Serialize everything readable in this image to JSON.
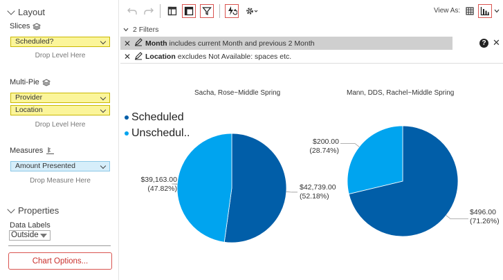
{
  "left_panel": {
    "layout_label": "Layout",
    "slices_label": "Slices",
    "slices_field": "Scheduled?",
    "slices_drop": "Drop Level Here",
    "multipie_label": "Multi-Pie",
    "multipie_fields": [
      "Provider",
      "Location"
    ],
    "multipie_drop": "Drop Level Here",
    "measures_label": "Measures",
    "measures_field": "Amount Presented",
    "measures_drop": "Drop Measure Here",
    "properties_label": "Properties",
    "data_labels_label": "Data Labels",
    "data_labels_value": "Outside",
    "chart_options_label": "Chart Options..."
  },
  "toolbar": {
    "view_as_label": "View As:"
  },
  "filters": {
    "header": "2 Filters",
    "rows": [
      {
        "field": "Month",
        "text": "includes current Month and previous 2 Month"
      },
      {
        "field": "Location",
        "text": "excludes Not Available: spaces etc."
      }
    ]
  },
  "colors": {
    "scheduled": "#015ea8",
    "unscheduled": "#00a4ef"
  },
  "chart_data": [
    {
      "type": "pie",
      "title": "Sacha, Rose~Middle Spring",
      "legend": [
        "Scheduled",
        "Unschedul.."
      ],
      "slices": [
        {
          "name": "Scheduled",
          "value": 42739.0,
          "label": "$42,739.00",
          "pct": "(52.18%)"
        },
        {
          "name": "Unscheduled",
          "value": 39163.0,
          "label": "$39,163.00",
          "pct": "(47.82%)"
        }
      ]
    },
    {
      "type": "pie",
      "title": "Mann, DDS, Rachel~Middle Spring",
      "slices": [
        {
          "name": "Scheduled",
          "value": 496.0,
          "label": "$496.00",
          "pct": "(71.26%)"
        },
        {
          "name": "Unscheduled",
          "value": 200.0,
          "label": "$200.00",
          "pct": "(28.74%)"
        }
      ]
    }
  ]
}
